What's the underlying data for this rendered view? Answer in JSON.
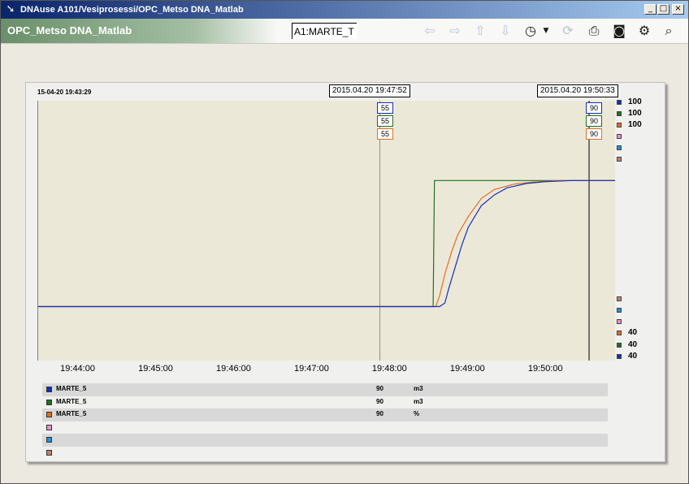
{
  "window": {
    "title": "DNAuse A101/Vesiprosessi/OPC_Metso DNA_Matlab",
    "minimize_glyph": "_",
    "maximize_glyph": "□",
    "close_glyph": "×"
  },
  "toolbar": {
    "tab_label": "OPC_Metso DNA_Matlab",
    "tag_value": "A1:MARTE_T",
    "icons": [
      "arrow-left-icon",
      "arrow-right-icon",
      "arrow-up-icon",
      "arrow-down-icon",
      "history-clock-icon",
      "dropdown-icon",
      "refresh-icon",
      "print-icon",
      "camera-icon",
      "settings-icon",
      "zoom-icon"
    ]
  },
  "trend": {
    "start_time": "15-04-20 19:43:29",
    "cursor1_label": "2015.04.20 19:47:52",
    "cursor2_label": "2015.04.20 19:50:33",
    "cursor1_values": [
      "55",
      "55",
      "55"
    ],
    "cursor2_values": [
      "90",
      "90",
      "90"
    ],
    "right_top_values": [
      "100",
      "100",
      "100"
    ],
    "right_bottom_values": [
      "40",
      "40",
      "40"
    ]
  },
  "chart_data": {
    "type": "line",
    "x_ticks": [
      "19:44:00",
      "19:45:00",
      "19:46:00",
      "19:47:00",
      "19:48:00",
      "19:49:00",
      "19:50:00"
    ],
    "xlim": [
      "19:43:29",
      "19:50:53"
    ],
    "ylim": [
      40,
      100
    ],
    "series": [
      {
        "name": "MARTE_5",
        "color": "#1030c0",
        "x": [
          "19:43:29",
          "19:48:38",
          "19:48:42",
          "19:48:45",
          "19:48:50",
          "19:48:55",
          "19:49:00",
          "19:49:10",
          "19:49:20",
          "19:49:30",
          "19:49:45",
          "19:50:00",
          "19:50:20",
          "19:50:53"
        ],
        "values": [
          55,
          55,
          56,
          60,
          66,
          72,
          77,
          83,
          86,
          88,
          89.2,
          89.7,
          90,
          90
        ]
      },
      {
        "name": "MARTE_5",
        "color": "#207020",
        "x": [
          "19:43:29",
          "19:48:33",
          "19:48:34",
          "19:50:53"
        ],
        "values": [
          55,
          55,
          90,
          90
        ]
      },
      {
        "name": "MARTE_5",
        "color": "#e07020",
        "x": [
          "19:43:29",
          "19:48:35",
          "19:48:38",
          "19:48:42",
          "19:48:47",
          "19:48:52",
          "19:49:00",
          "19:49:10",
          "19:49:20",
          "19:49:35",
          "19:49:50",
          "19:50:10",
          "19:50:53"
        ],
        "values": [
          55,
          55,
          58,
          64,
          70,
          75,
          80,
          85,
          87.5,
          89,
          89.6,
          90,
          90
        ]
      }
    ],
    "cursors": [
      "19:47:52",
      "19:50:33"
    ]
  },
  "legend": [
    {
      "name": "MARTE_5",
      "value": "90",
      "unit": "m3",
      "color": "#1030c0"
    },
    {
      "name": "MARTE_5",
      "value": "90",
      "unit": "m3",
      "color": "#207020"
    },
    {
      "name": "MARTE_5",
      "value": "90",
      "unit": "%",
      "color": "#e07020"
    },
    {
      "name": "",
      "value": "",
      "unit": "",
      "color": "#e890c8"
    },
    {
      "name": "",
      "value": "",
      "unit": "",
      "color": "#2090e0"
    },
    {
      "name": "",
      "value": "",
      "unit": "",
      "color": "#c08070"
    }
  ],
  "colors": {
    "blue": "#1030c0",
    "green": "#207020",
    "orange": "#e07020",
    "pink": "#e890c8",
    "cyan": "#2090e0",
    "brown": "#c08070"
  }
}
